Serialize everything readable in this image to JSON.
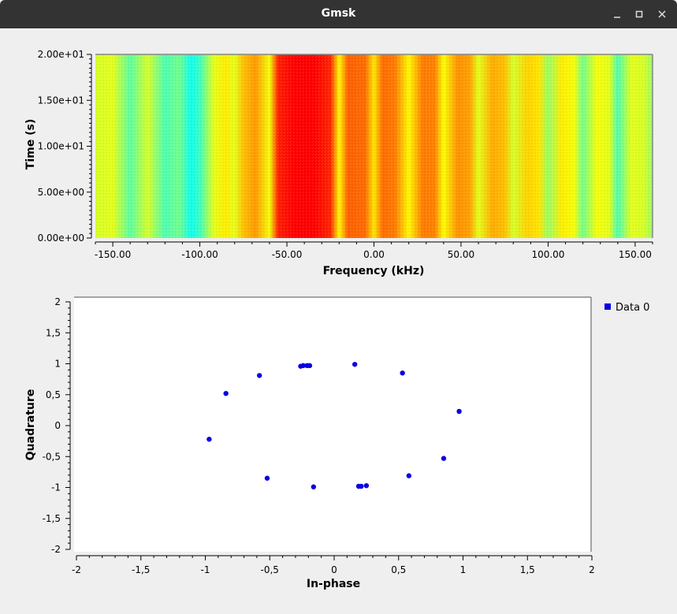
{
  "window": {
    "title": "Gmsk",
    "minimize_icon": "minimize-icon",
    "maximize_icon": "maximize-icon",
    "close_icon": "close-icon"
  },
  "colors": {
    "titlebar": "#333333",
    "background": "#efefef",
    "points": "#0a00e0",
    "waterfall_scale": [
      "#00ffff",
      "#ffff00",
      "#ff8000",
      "#ff0000"
    ]
  },
  "chart_data": [
    {
      "type": "heatmap",
      "title": "",
      "xlabel": "Frequency (kHz)",
      "ylabel": "Time (s)",
      "xlim": [
        -160,
        160
      ],
      "ylim": [
        0,
        20
      ],
      "x_ticks": [
        -150,
        -100,
        -50,
        0,
        50,
        100,
        150
      ],
      "x_tick_labels": [
        "-150.00",
        "-100.00",
        "-50.00",
        "0.00",
        "50.00",
        "100.00",
        "150.00"
      ],
      "y_ticks": [
        0,
        5,
        10,
        15,
        20
      ],
      "y_tick_labels": [
        "0.00e+00",
        "5.00e+00",
        "1.00e+01",
        "1.50e+01",
        "2.00e+01"
      ],
      "intensity_by_frequency": [
        {
          "f": -160,
          "v": 0.28
        },
        {
          "f": -150,
          "v": 0.3
        },
        {
          "f": -140,
          "v": 0.12
        },
        {
          "f": -130,
          "v": 0.28
        },
        {
          "f": -120,
          "v": 0.1
        },
        {
          "f": -112,
          "v": 0.15
        },
        {
          "f": -105,
          "v": 0.02
        },
        {
          "f": -100,
          "v": 0.08
        },
        {
          "f": -92,
          "v": 0.3
        },
        {
          "f": -85,
          "v": 0.38
        },
        {
          "f": -80,
          "v": 0.3
        },
        {
          "f": -75,
          "v": 0.5
        },
        {
          "f": -68,
          "v": 0.6
        },
        {
          "f": -60,
          "v": 0.32
        },
        {
          "f": -55,
          "v": 0.92
        },
        {
          "f": -45,
          "v": 1.0
        },
        {
          "f": -35,
          "v": 1.0
        },
        {
          "f": -25,
          "v": 0.9
        },
        {
          "f": -20,
          "v": 0.35
        },
        {
          "f": -15,
          "v": 0.75
        },
        {
          "f": -5,
          "v": 0.72
        },
        {
          "f": 0,
          "v": 0.4
        },
        {
          "f": 5,
          "v": 0.72
        },
        {
          "f": 12,
          "v": 0.68
        },
        {
          "f": 20,
          "v": 0.35
        },
        {
          "f": 28,
          "v": 0.68
        },
        {
          "f": 35,
          "v": 0.66
        },
        {
          "f": 40,
          "v": 0.33
        },
        {
          "f": 48,
          "v": 0.62
        },
        {
          "f": 55,
          "v": 0.58
        },
        {
          "f": 60,
          "v": 0.3
        },
        {
          "f": 68,
          "v": 0.55
        },
        {
          "f": 75,
          "v": 0.5
        },
        {
          "f": 80,
          "v": 0.28
        },
        {
          "f": 88,
          "v": 0.45
        },
        {
          "f": 95,
          "v": 0.4
        },
        {
          "f": 100,
          "v": 0.2
        },
        {
          "f": 108,
          "v": 0.38
        },
        {
          "f": 115,
          "v": 0.32
        },
        {
          "f": 120,
          "v": 0.15
        },
        {
          "f": 128,
          "v": 0.32
        },
        {
          "f": 135,
          "v": 0.3
        },
        {
          "f": 140,
          "v": 0.1
        },
        {
          "f": 148,
          "v": 0.3
        },
        {
          "f": 155,
          "v": 0.28
        },
        {
          "f": 160,
          "v": 0.2
        }
      ]
    },
    {
      "type": "scatter",
      "title": "",
      "xlabel": "In-phase",
      "ylabel": "Quadrature",
      "xlim": [
        -2,
        2
      ],
      "ylim": [
        -2,
        2
      ],
      "x_ticks": [
        -2,
        -1.5,
        -1,
        -0.5,
        0,
        0.5,
        1,
        1.5,
        2
      ],
      "x_tick_labels": [
        "-2",
        "-1,5",
        "-1",
        "-0,5",
        "0",
        "0,5",
        "1",
        "1,5",
        "2"
      ],
      "y_ticks": [
        -2,
        -1.5,
        -1,
        -0.5,
        0,
        0.5,
        1,
        1.5,
        2
      ],
      "y_tick_labels": [
        "-2",
        "-1,5",
        "-1",
        "-0,5",
        "0",
        "0,5",
        "1",
        "1,5",
        "2"
      ],
      "legend": "top-right",
      "series": [
        {
          "name": "Data 0",
          "points": [
            [
              -0.97,
              -0.22
            ],
            [
              -0.84,
              0.52
            ],
            [
              -0.58,
              0.81
            ],
            [
              -0.52,
              -0.85
            ],
            [
              -0.26,
              0.96
            ],
            [
              -0.24,
              0.97
            ],
            [
              -0.21,
              0.97
            ],
            [
              -0.19,
              0.97
            ],
            [
              -0.16,
              -0.99
            ],
            [
              0.16,
              0.99
            ],
            [
              0.19,
              -0.98
            ],
            [
              0.21,
              -0.98
            ],
            [
              0.25,
              -0.97
            ],
            [
              0.53,
              0.85
            ],
            [
              0.58,
              -0.81
            ],
            [
              0.85,
              -0.53
            ],
            [
              0.97,
              0.23
            ]
          ]
        }
      ]
    }
  ]
}
